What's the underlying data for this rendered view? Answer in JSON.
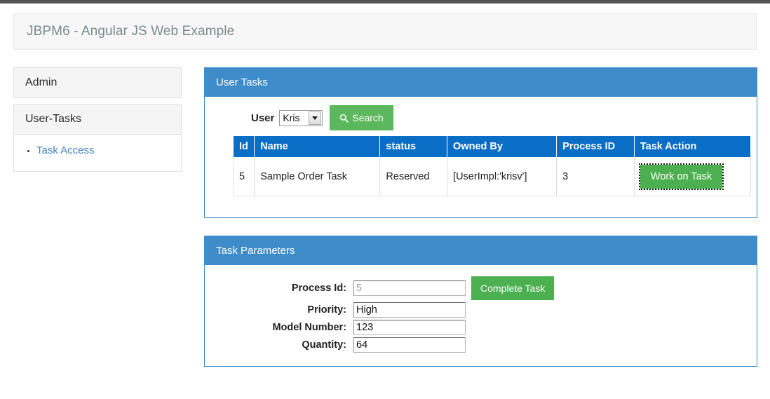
{
  "chrome": {
    "accent_bar_color": "#555555"
  },
  "header": {
    "title": "JBPM6 - Angular JS Web Example"
  },
  "sidebar": {
    "panels": [
      {
        "heading": "Admin",
        "links": []
      },
      {
        "heading": "User-Tasks",
        "links": [
          {
            "label": "Task Access"
          }
        ]
      }
    ]
  },
  "user_tasks_panel": {
    "heading": "User Tasks",
    "search": {
      "user_label": "User",
      "selected_user": "Kris",
      "search_button_label": "Search",
      "search_icon": "magnifier-icon"
    },
    "table": {
      "columns": [
        "Id",
        "Name",
        "status",
        "Owned By",
        "Process ID",
        "Task Action"
      ],
      "rows": [
        {
          "id": "5",
          "name": "Sample Order Task",
          "status": "Reserved",
          "owned_by": "[UserImpl:'krisv']",
          "process_id": "3",
          "action_label": "Work on Task"
        }
      ]
    }
  },
  "task_parameters_panel": {
    "heading": "Task Parameters",
    "fields": [
      {
        "label": "Process Id:",
        "value": "5",
        "muted": true
      },
      {
        "label": "Priority:",
        "value": "High",
        "muted": false
      },
      {
        "label": "Model Number:",
        "value": "123",
        "muted": false
      },
      {
        "label": "Quantity:",
        "value": "64",
        "muted": false
      }
    ],
    "complete_button_label": "Complete Task"
  },
  "colors": {
    "panel_header_blue": "#3f8ccb",
    "table_header_blue": "#0a6dc6",
    "green_button": "#4caf50",
    "search_green": "#5cb85c",
    "link_blue": "#4383c4"
  }
}
